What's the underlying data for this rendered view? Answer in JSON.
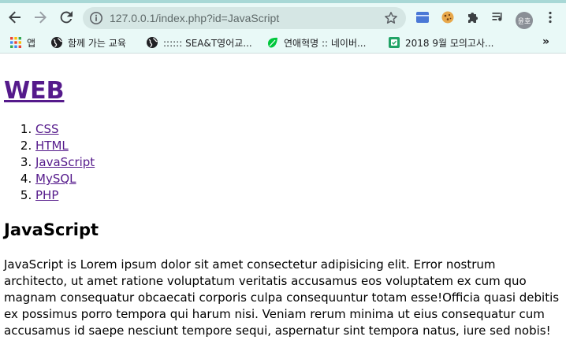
{
  "browser": {
    "url": "127.0.0.1/index.php?id=JavaScript",
    "profile_initials": "윤호",
    "bookmarks": [
      {
        "label": "앱"
      },
      {
        "label": "함께 가는 교육"
      },
      {
        "label": ":::::: SEA&T영어교..."
      },
      {
        "label": "연애혁명 :: 네이버..."
      },
      {
        "label": "2018 9월 모의고사..."
      }
    ],
    "bookmarks_more": "»"
  },
  "page": {
    "site_title": "WEB",
    "nav": [
      "CSS",
      "HTML",
      "JavaScript",
      "MySQL",
      "PHP"
    ],
    "heading": "JavaScript",
    "body": "JavaScript is Lorem ipsum dolor sit amet consectetur adipisicing elit. Error nostrum architecto, ut amet ratione voluptatum veritatis accusamus eos voluptatem ex cum quo magnam consequatur obcaecati corporis culpa consequuntur totam esse!Officia quasi debitis ex possimus porro tempora qui harum nisi. Veniam rerum minima ut eius consequatur cum accusamus id saepe nesciunt tempore sequi, aspernatur sint tempora natus, iure sed nobis!"
  },
  "colors": {
    "toolbar_bg": "#e9f9f7",
    "omnibox_bg": "#d5e6e4",
    "visited_link": "#551a8b"
  }
}
